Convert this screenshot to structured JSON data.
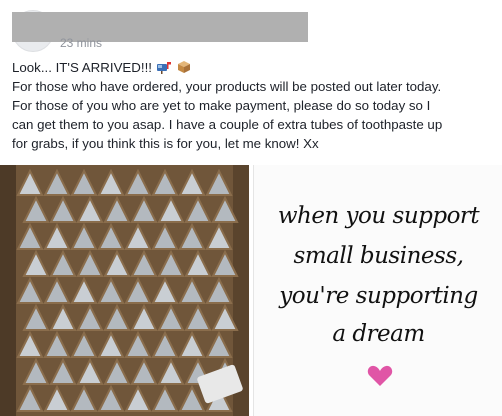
{
  "post": {
    "timestamp": "23 mins",
    "text_line_1": "Look... IT'S ARRIVED!!!",
    "text_body": "For those who have ordered, your products will be posted out later today.\nFor those of you who are yet to make payment, please do so today so I\ncan get them to you asap. I have a couple of extra tubes of toothpaste up\nfor grabs, if you think this is for you, let me know! Xx",
    "emojis": [
      "mailbox-icon",
      "package-icon"
    ]
  },
  "quote": {
    "line1": "when you support",
    "line2": "small business,",
    "line3": "you're supporting",
    "line4": "a dream",
    "heart_color": "#e055a6"
  },
  "colors": {
    "text": "#1d2129",
    "muted": "#90949c",
    "box": "#6e5236"
  }
}
